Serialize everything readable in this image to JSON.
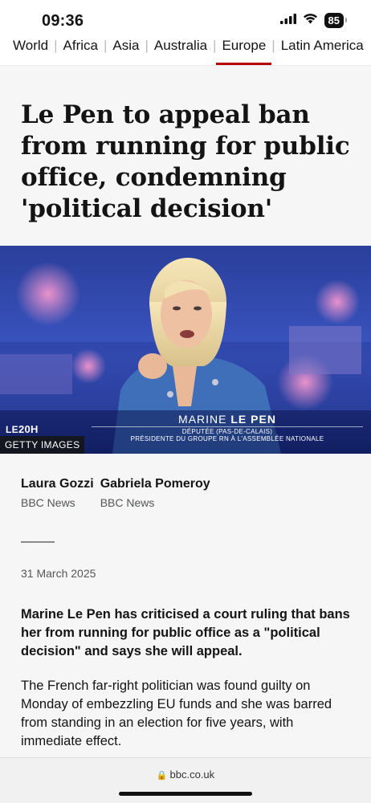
{
  "status_bar": {
    "time": "09:36",
    "battery": "85",
    "icons": [
      "signal-icon",
      "wifi-icon",
      "battery-icon"
    ]
  },
  "nav": {
    "items": [
      {
        "label": "World",
        "active": false
      },
      {
        "label": "Africa",
        "active": false
      },
      {
        "label": "Asia",
        "active": false
      },
      {
        "label": "Australia",
        "active": false
      },
      {
        "label": "Europe",
        "active": true
      },
      {
        "label": "Latin America",
        "active": false
      }
    ]
  },
  "article": {
    "headline": "Le Pen to appeal ban from running for public office, condemning 'political decision'",
    "image": {
      "credit": "GETTY IMAGES",
      "tv_logo_prefix": "LE",
      "tv_logo_suffix": "20H",
      "lower_third_first": "MARINE",
      "lower_third_last": "LE PEN",
      "lower_third_role_1": "DÉPUTÉE (PAS-DE-CALAIS)",
      "lower_third_role_2": "PRÉSIDENTE DU GROUPE RN À L'ASSEMBLÉE NATIONALE"
    },
    "authors": [
      {
        "name": "Laura Gozzi",
        "org": "BBC News"
      },
      {
        "name": "Gabriela Pomeroy",
        "org": "BBC News"
      }
    ],
    "date": "31 March 2025",
    "lede": "Marine Le Pen has criticised a court ruling that bans her from running for public office as a \"political decision\" and says she will appeal.",
    "paragraph": "The French far-right politician was found guilty on Monday of embezzling EU funds and she was barred from standing in an election for five years, with immediate effect."
  },
  "browser": {
    "url": "bbc.co.uk"
  },
  "colors": {
    "accent": "#b80000",
    "text": "#141414",
    "muted": "#545658",
    "background": "#f6f6f6"
  }
}
